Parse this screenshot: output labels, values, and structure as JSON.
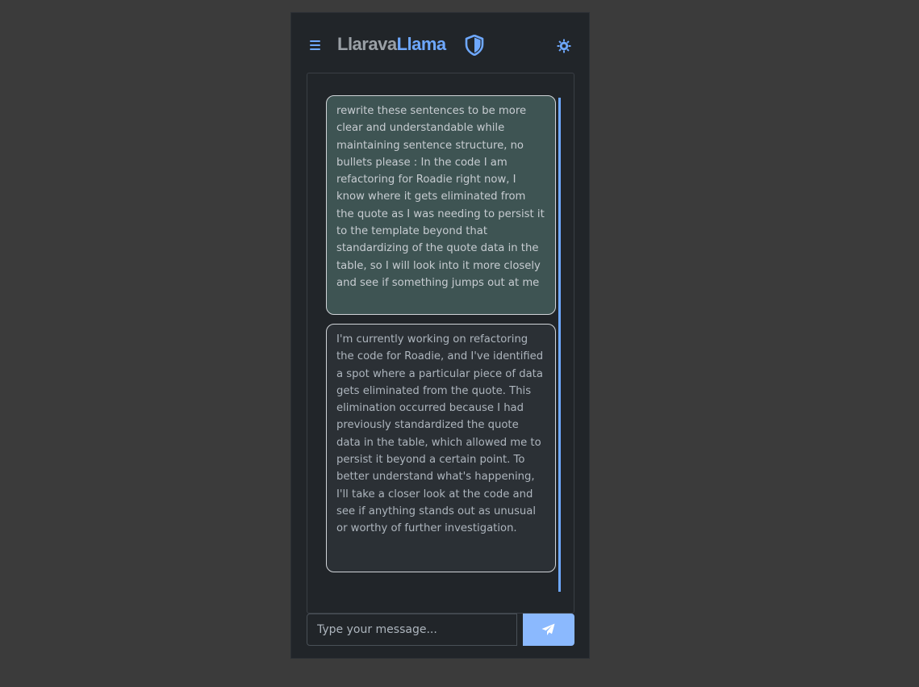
{
  "header": {
    "brand_part1": "Llarava",
    "brand_part2": "Llama",
    "menu_icon": "hamburger-menu-icon",
    "shield_icon": "shield-half-icon",
    "theme_icon": "sun-gear-icon",
    "accent_color": "#6ea8fe"
  },
  "chat": {
    "messages": [
      {
        "role": "user",
        "text": "rewrite these sentences to be more clear and understandable while maintaining sentence structure, no bullets please : In the code I am refactoring for Roadie right now, I know where it gets eliminated from the quote as I was needing to persist it to the template beyond that standardizing of the quote data in the table, so I will look into it more closely and see if something jumps out at me"
      },
      {
        "role": "assistant",
        "text": "I'm currently working on refactoring the code for Roadie, and I've identified a spot where a particular piece of data gets eliminated from the quote. This elimination occurred because I had previously standardized the quote data in the table, which allowed me to persist it beyond a certain point. To better understand what's happening, I'll take a closer look at the code and see if anything stands out as unusual or worthy of further investigation."
      }
    ]
  },
  "composer": {
    "placeholder": "Type your message...",
    "send_icon": "paper-plane-icon"
  }
}
